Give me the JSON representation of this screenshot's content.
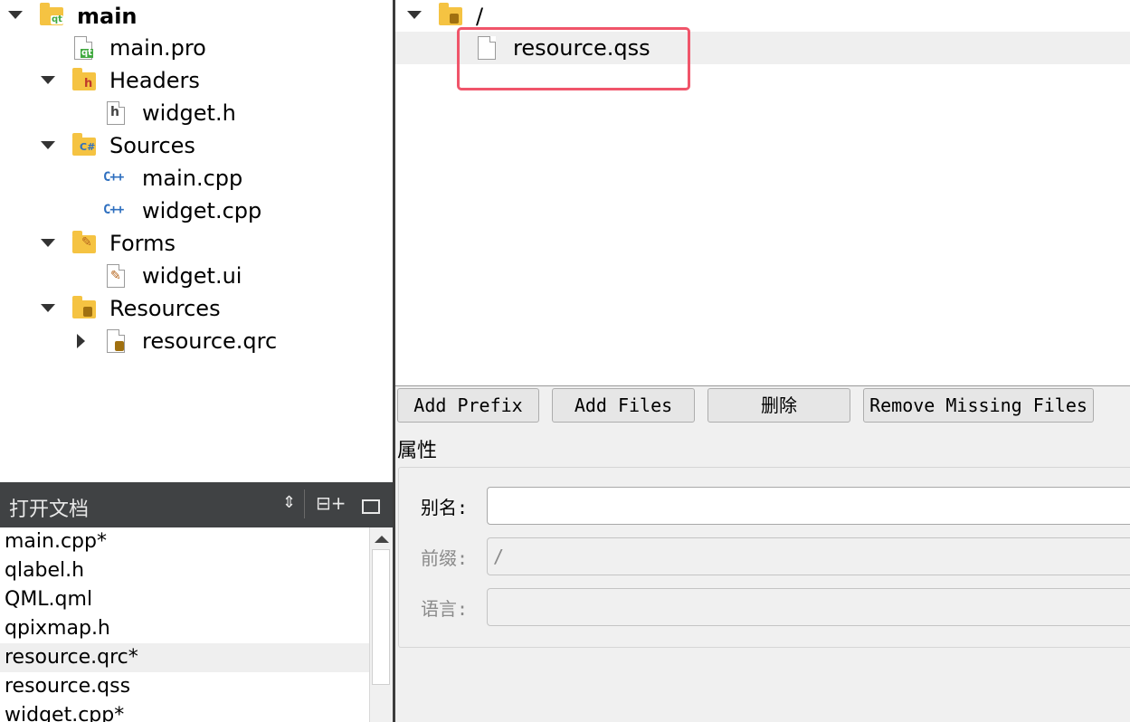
{
  "project_tree": {
    "root": "main",
    "items": [
      {
        "label": "main.pro"
      },
      {
        "label": "Headers"
      },
      {
        "label": "widget.h"
      },
      {
        "label": "Sources"
      },
      {
        "label": "main.cpp"
      },
      {
        "label": "widget.cpp"
      },
      {
        "label": "Forms"
      },
      {
        "label": "widget.ui"
      },
      {
        "label": "Resources"
      },
      {
        "label": "resource.qrc"
      }
    ]
  },
  "open_documents": {
    "title": "打开文档",
    "items": [
      {
        "label": "main.cpp*"
      },
      {
        "label": "qlabel.h"
      },
      {
        "label": "QML.qml"
      },
      {
        "label": "qpixmap.h"
      },
      {
        "label": "resource.qrc*"
      },
      {
        "label": "resource.qss"
      },
      {
        "label": "widget.cpp*"
      }
    ],
    "selected": "resource.qrc*"
  },
  "resource_tree": {
    "prefix": "/",
    "file": "resource.qss"
  },
  "buttons": {
    "add_prefix": "Add Prefix",
    "add_files": "Add Files",
    "delete": "删除",
    "remove_missing": "Remove Missing Files"
  },
  "properties": {
    "title": "属性",
    "alias_label": "别名:",
    "alias_value": "",
    "prefix_label": "前缀:",
    "prefix_value": "/",
    "language_label": "语言:",
    "language_value": ""
  },
  "colors": {
    "highlight_box": "#f0556a",
    "header_bg": "#404244",
    "folder": "#f5c342"
  }
}
